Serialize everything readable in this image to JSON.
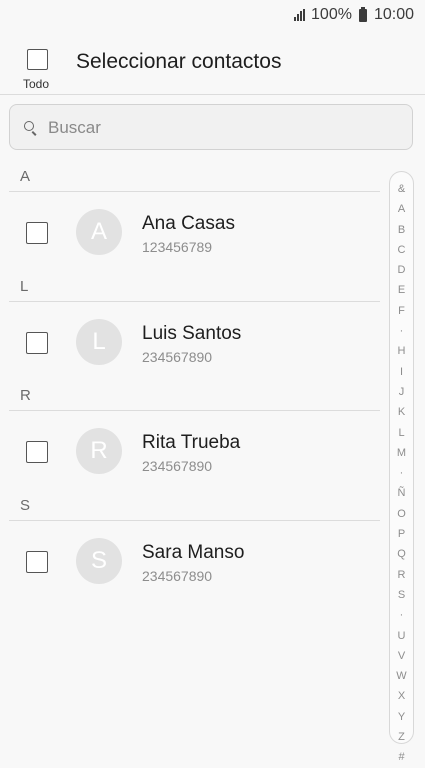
{
  "status_bar": {
    "battery": "100%",
    "time": "10:00"
  },
  "header": {
    "select_all_label": "Todo",
    "title": "Seleccionar contactos"
  },
  "search": {
    "placeholder": "Buscar"
  },
  "sections": [
    {
      "letter": "A",
      "contact": {
        "initial": "A",
        "name": "Ana Casas",
        "phone": "123456789"
      }
    },
    {
      "letter": "L",
      "contact": {
        "initial": "L",
        "name": "Luis Santos",
        "phone": "234567890"
      }
    },
    {
      "letter": "R",
      "contact": {
        "initial": "R",
        "name": "Rita Trueba",
        "phone": "234567890"
      }
    },
    {
      "letter": "S",
      "contact": {
        "initial": "S",
        "name": "Sara Manso",
        "phone": "234567890"
      }
    }
  ],
  "index_letters": [
    "&",
    "A",
    "B",
    "C",
    "D",
    "E",
    "F",
    "·",
    "H",
    "I",
    "J",
    "K",
    "L",
    "M",
    "·",
    "Ñ",
    "O",
    "P",
    "Q",
    "R",
    "S",
    "·",
    "U",
    "V",
    "W",
    "X",
    "Y",
    "Z",
    "#"
  ],
  "colors": {
    "avatar_bg": "#e2e2e2",
    "background": "#f8f8f8"
  }
}
